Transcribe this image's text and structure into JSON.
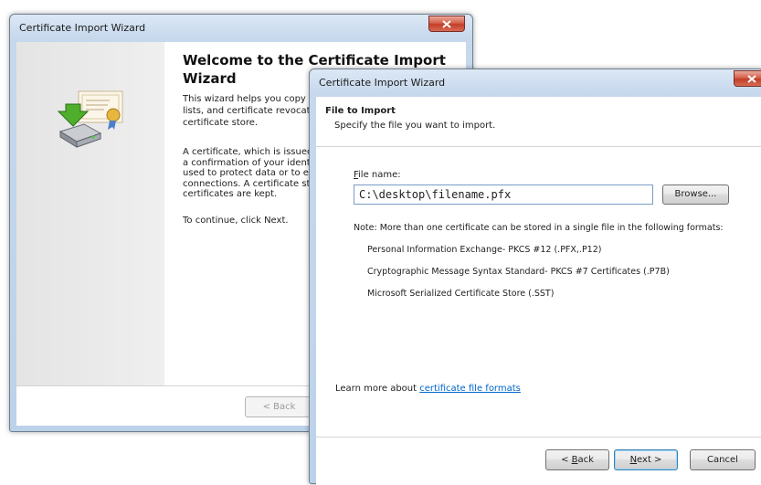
{
  "back_window": {
    "title": "Certificate Import Wizard",
    "heading_line1": "Welcome to the Certificate Import",
    "heading_line2": "Wizard",
    "para1_lines": [
      "This wizard helps you copy ce",
      "lists, and certificate revocatio",
      "certificate store."
    ],
    "para2_lines": [
      "A certificate, which is issued b",
      "a confirmation of your identity",
      "used to protect data or to est",
      "connections. A certificate stor",
      "certificates are kept."
    ],
    "continue_text": "To continue, click Next.",
    "back_button": "< Back"
  },
  "front_window": {
    "title": "Certificate Import Wizard",
    "header_title": "File to Import",
    "header_subtitle": "Specify the file you want to import.",
    "file_label_access": "F",
    "file_label_rest": "ile name:",
    "file_value": "C:\\desktop\\filename.pfx",
    "browse_button": "Browse...",
    "note": "Note:  More than one certificate can be stored in a single file in the following formats:",
    "formats": [
      "Personal Information Exchange- PKCS #12 (.PFX,.P12)",
      "Cryptographic Message Syntax Standard- PKCS #7 Certificates (.P7B)",
      "Microsoft Serialized Certificate Store (.SST)"
    ],
    "learn_more_prefix": "Learn more about ",
    "learn_more_link": "certificate file formats",
    "back_btn_prefix": "< ",
    "back_btn_access": "B",
    "back_btn_rest": "ack",
    "next_btn_access": "N",
    "next_btn_rest": "ext >",
    "cancel_button": "Cancel"
  }
}
